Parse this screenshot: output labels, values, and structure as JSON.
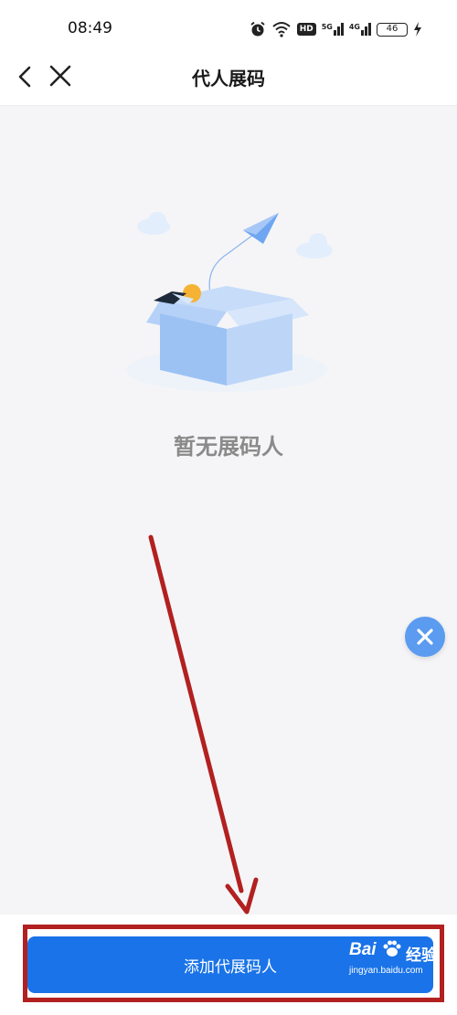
{
  "status_bar": {
    "time": "08:49",
    "icons": [
      "alarm-icon",
      "wifi-icon",
      "hd-icon",
      "signal-5g-icon",
      "signal-4g-icon",
      "battery-icon",
      "charging-icon"
    ],
    "hd_label": "HD",
    "signal_1_label": "5G",
    "signal_2_label": "4G",
    "battery_level": "46"
  },
  "nav": {
    "title": "代人展码",
    "back_icon": "chevron-left-icon",
    "close_icon": "close-icon"
  },
  "empty_state": {
    "illustration": "empty-box-paper-plane-illustration",
    "text": "暂无展码人"
  },
  "float_button": {
    "icon": "close-icon"
  },
  "bottom": {
    "add_button_label": "添加代展码人"
  },
  "annotations": {
    "highlight_color": "#b22020",
    "arrow_color": "#b22020"
  },
  "watermark": {
    "logo_left": "Bai",
    "logo_right": "经验",
    "url": "jingyan.baidu.com"
  },
  "colors": {
    "primary": "#1a73e8",
    "float_button": "#5b9bf0",
    "background": "#f5f5f7"
  }
}
